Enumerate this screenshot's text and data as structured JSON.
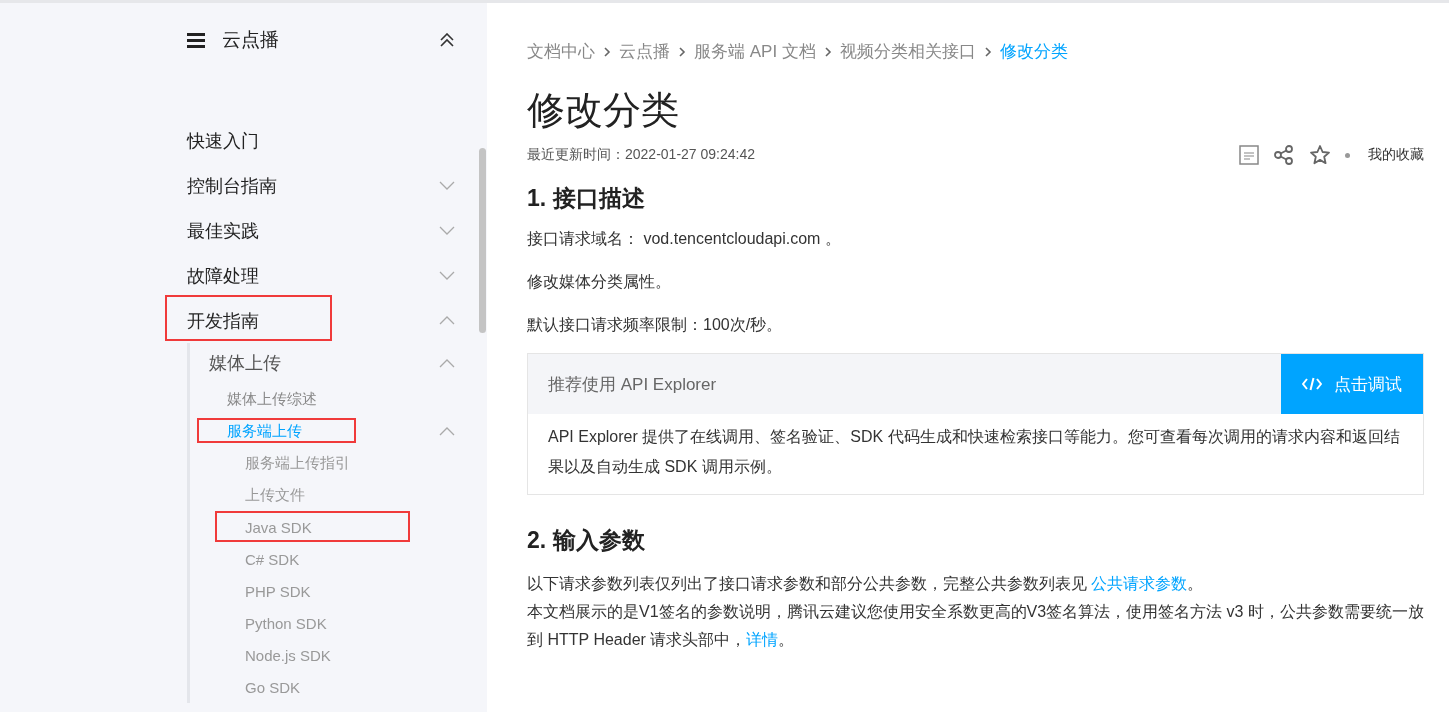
{
  "sidebar": {
    "title": "云点播",
    "items": [
      {
        "label": "快速入门"
      },
      {
        "label": "控制台指南",
        "expanded": false
      },
      {
        "label": "最佳实践",
        "expanded": false
      },
      {
        "label": "故障处理",
        "expanded": false
      },
      {
        "label": "开发指南",
        "expanded": true,
        "annotated": true,
        "children": [
          {
            "label": "媒体上传",
            "expanded": true,
            "children": [
              {
                "label": "媒体上传综述",
                "selected": false
              },
              {
                "label": "服务端上传",
                "expanded": true,
                "selected": true,
                "annotated": true,
                "children": [
                  {
                    "label": "服务端上传指引",
                    "selected": false
                  },
                  {
                    "label": "上传文件",
                    "selected": false
                  },
                  {
                    "label": "Java SDK",
                    "selected": false,
                    "annotated": true
                  },
                  {
                    "label": "C# SDK",
                    "selected": false
                  },
                  {
                    "label": "PHP SDK",
                    "selected": false
                  },
                  {
                    "label": "Python SDK",
                    "selected": false
                  },
                  {
                    "label": "Node.js SDK",
                    "selected": false
                  },
                  {
                    "label": "Go SDK",
                    "selected": false
                  }
                ]
              }
            ]
          }
        ]
      }
    ]
  },
  "breadcrumb": [
    {
      "label": "文档中心",
      "current": false
    },
    {
      "label": "云点播",
      "current": false
    },
    {
      "label": "服务端 API 文档",
      "current": false
    },
    {
      "label": "视频分类相关接口",
      "current": false
    },
    {
      "label": "修改分类",
      "current": true
    }
  ],
  "title": "修改分类",
  "updated": "最近更新时间：2022-01-27 09:24:42",
  "favorites": "我的收藏",
  "sections": [
    {
      "heading": "1. 接口描述",
      "paragraphs": [
        "接口请求域名： vod.tencentcloudapi.com 。",
        "修改媒体分类属性。",
        "默认接口请求频率限制：100次/秒。"
      ],
      "explorer": {
        "title": "推荐使用 API Explorer",
        "button": "点击调试",
        "text": "API Explorer 提供了在线调用、签名验证、SDK 代码生成和快速检索接口等能力。您可查看每次调用的请求内容和返回结果以及自动生成 SDK 调用示例。"
      }
    },
    {
      "heading": "2. 输入参数",
      "lines": [
        {
          "text": "以下请求参数列表仅列出了接口请求参数和部分公共参数，完整公共参数列表见 ",
          "link": "公共请求参数",
          "after": "。"
        },
        {
          "text": "本文档展示的是V1签名的参数说明，腾讯云建议您使用安全系数更高的V3签名算法，使用签名方法 v3 时，公共参数需要统一放到 HTTP Header 请求头部中，",
          "link": "详情",
          "after": "。"
        }
      ]
    }
  ]
}
